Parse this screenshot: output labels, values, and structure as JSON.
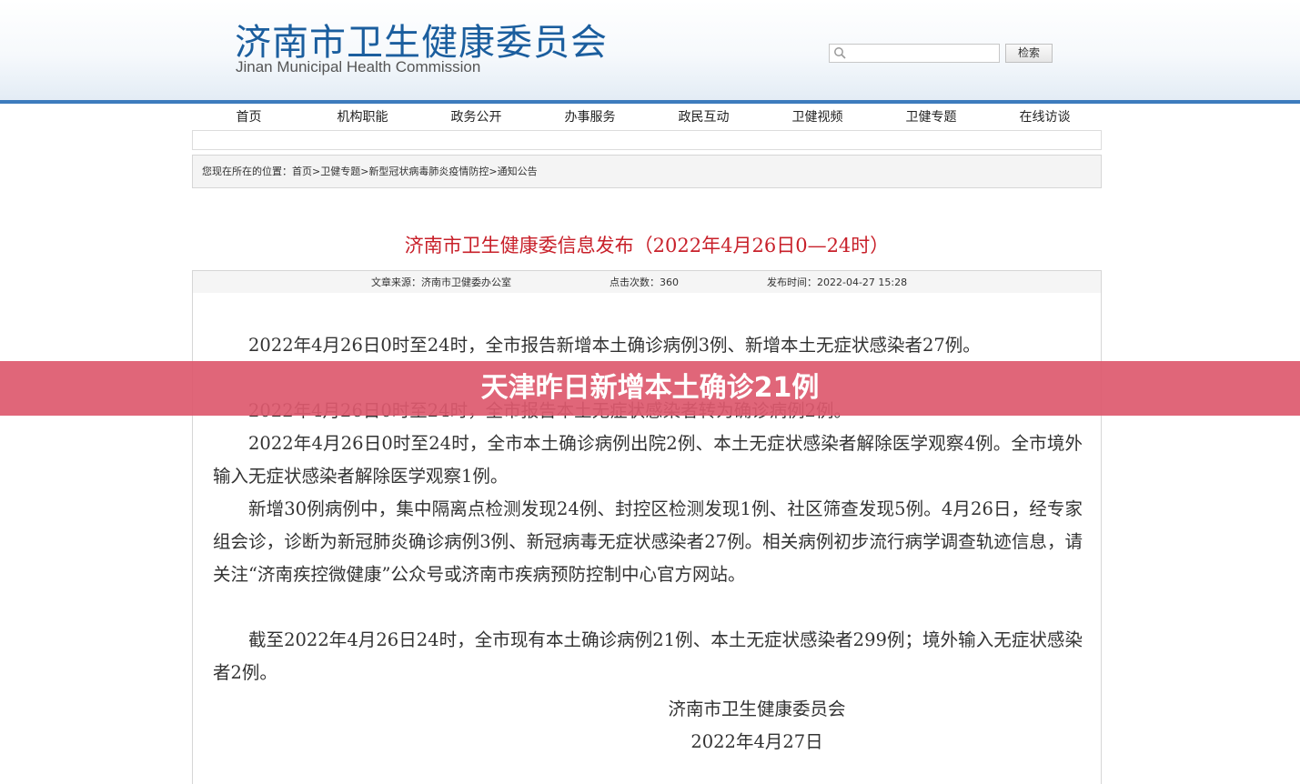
{
  "header": {
    "org_name_cn": "济南市卫生健康委员会",
    "org_name_en": "Jinan Municipal Health Commission",
    "search_placeholder": "",
    "search_button": "检索"
  },
  "nav": {
    "items": [
      "首页",
      "机构职能",
      "政务公开",
      "办事服务",
      "政民互动",
      "卫健视频",
      "卫健专题",
      "在线访谈"
    ]
  },
  "breadcrumb": {
    "prefix": "您现在所在的位置：",
    "items": [
      "首页>",
      "卫健专题>",
      "新型冠状病毒肺炎疫情防控>",
      "通知公告"
    ]
  },
  "article": {
    "title": "济南市卫生健康委信息发布（2022年4月26日0—24时）",
    "meta": {
      "source": "文章来源：济南市卫健委办公室",
      "clicks": "点击次数：360",
      "publish_time": "发布时间：2022-04-27 15:28"
    },
    "paragraphs": [
      "2022年4月26日0时至24时，全市报告新增本土确诊病例3例、新增本土无症状感染者27例。",
      "2022年4月26日0时至24时，全市报告本土无症状感染者转为确诊病例2例。",
      "2022年4月26日0时至24时，全市本土确诊病例出院2例、本土无症状感染者解除医学观察4例。全市境外输入无症状感染者解除医学观察1例。",
      "新增30例病例中，集中隔离点检测发现24例、封控区检测发现1例、社区筛查发现5例。4月26日，经专家组会诊，诊断为新冠肺炎确诊病例3例、新冠病毒无症状感染者27例。相关病例初步流行病学调查轨迹信息，请关注“济南疾控微健康”公众号或济南市疾病预防控制中心官方网站。",
      "截至2022年4月26日24时，全市现有本土确诊病例21例、本土无症状感染者299例；境外输入无症状感染者2例。"
    ],
    "signature": "济南市卫生健康委员会",
    "date": "2022年4月27日"
  },
  "overlay": {
    "headline": "天津昨日新增本土确诊21例"
  }
}
